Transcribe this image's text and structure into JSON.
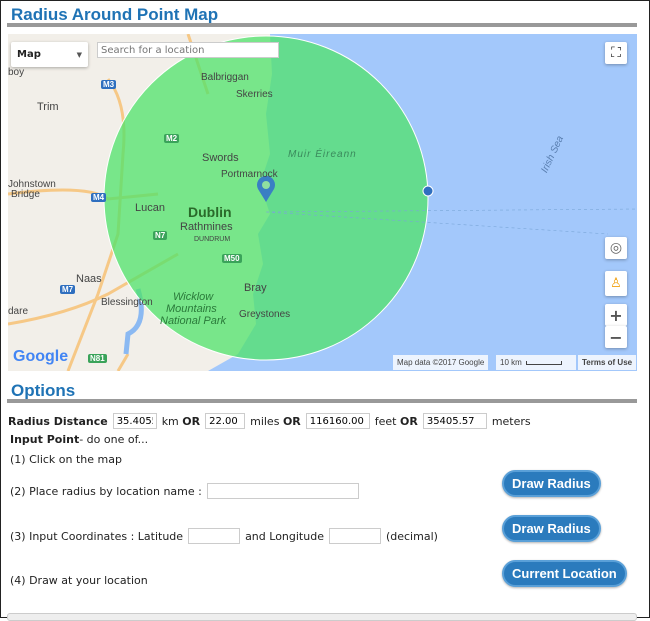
{
  "title": "Radius Around Point Map",
  "map": {
    "type_select": "Map",
    "search_placeholder": "Search for a location",
    "labels": {
      "boy": "boy",
      "trim": "Trim",
      "johnstown": "Johnstown",
      "bridge": "Bridge",
      "balbriggan": "Balbriggan",
      "skerries": "Skerries",
      "swords": "Swords",
      "portmarnock": "Portmarnock",
      "muir": "Muir Éireann",
      "irish_sea": "Irish Sea",
      "lucan": "Lucan",
      "dublin": "Dublin",
      "rathmines": "Rathmines",
      "dundrum": "DUNDRUM",
      "naas": "Naas",
      "blessington": "Blessington",
      "bray": "Bray",
      "greystones": "Greystones",
      "wicklow1": "Wicklow",
      "wicklow2": "Mountains",
      "wicklow3": "National Park",
      "dare": "dare"
    },
    "shields": {
      "m3": "M3",
      "m2": "M2",
      "m4": "M4",
      "n7": "N7",
      "m50": "M50",
      "m7": "M7",
      "n81": "N81"
    },
    "logo": "Google",
    "attribution": "Map data ©2017 Google",
    "scale": "10 km",
    "terms": "Terms of Use",
    "colors": {
      "circle": "#4fe36a",
      "sea": "#a3c8fb",
      "land": "#f2efe9"
    }
  },
  "options": {
    "title": "Options",
    "radius_label": "Radius Distance",
    "km_value": "35.4055",
    "km_unit": "km",
    "or": "OR",
    "miles_value": "22.00",
    "miles_unit": "miles",
    "feet_value": "116160.00",
    "feet_unit": "feet",
    "meters_value": "35405.57",
    "meters_unit": "meters",
    "input_point_bold": "Input Point",
    "input_point_rest": " - do one of...",
    "step1": "(1)  Click on the map",
    "step2": "(2)  Place radius by location name :",
    "step3a": "(3)  Input Coordinates : Latitude",
    "step3b": "and Longitude",
    "step3c": "(decimal)",
    "step4": "(4)  Draw at your location",
    "draw_radius": "Draw Radius",
    "current_location": "Current Location"
  }
}
